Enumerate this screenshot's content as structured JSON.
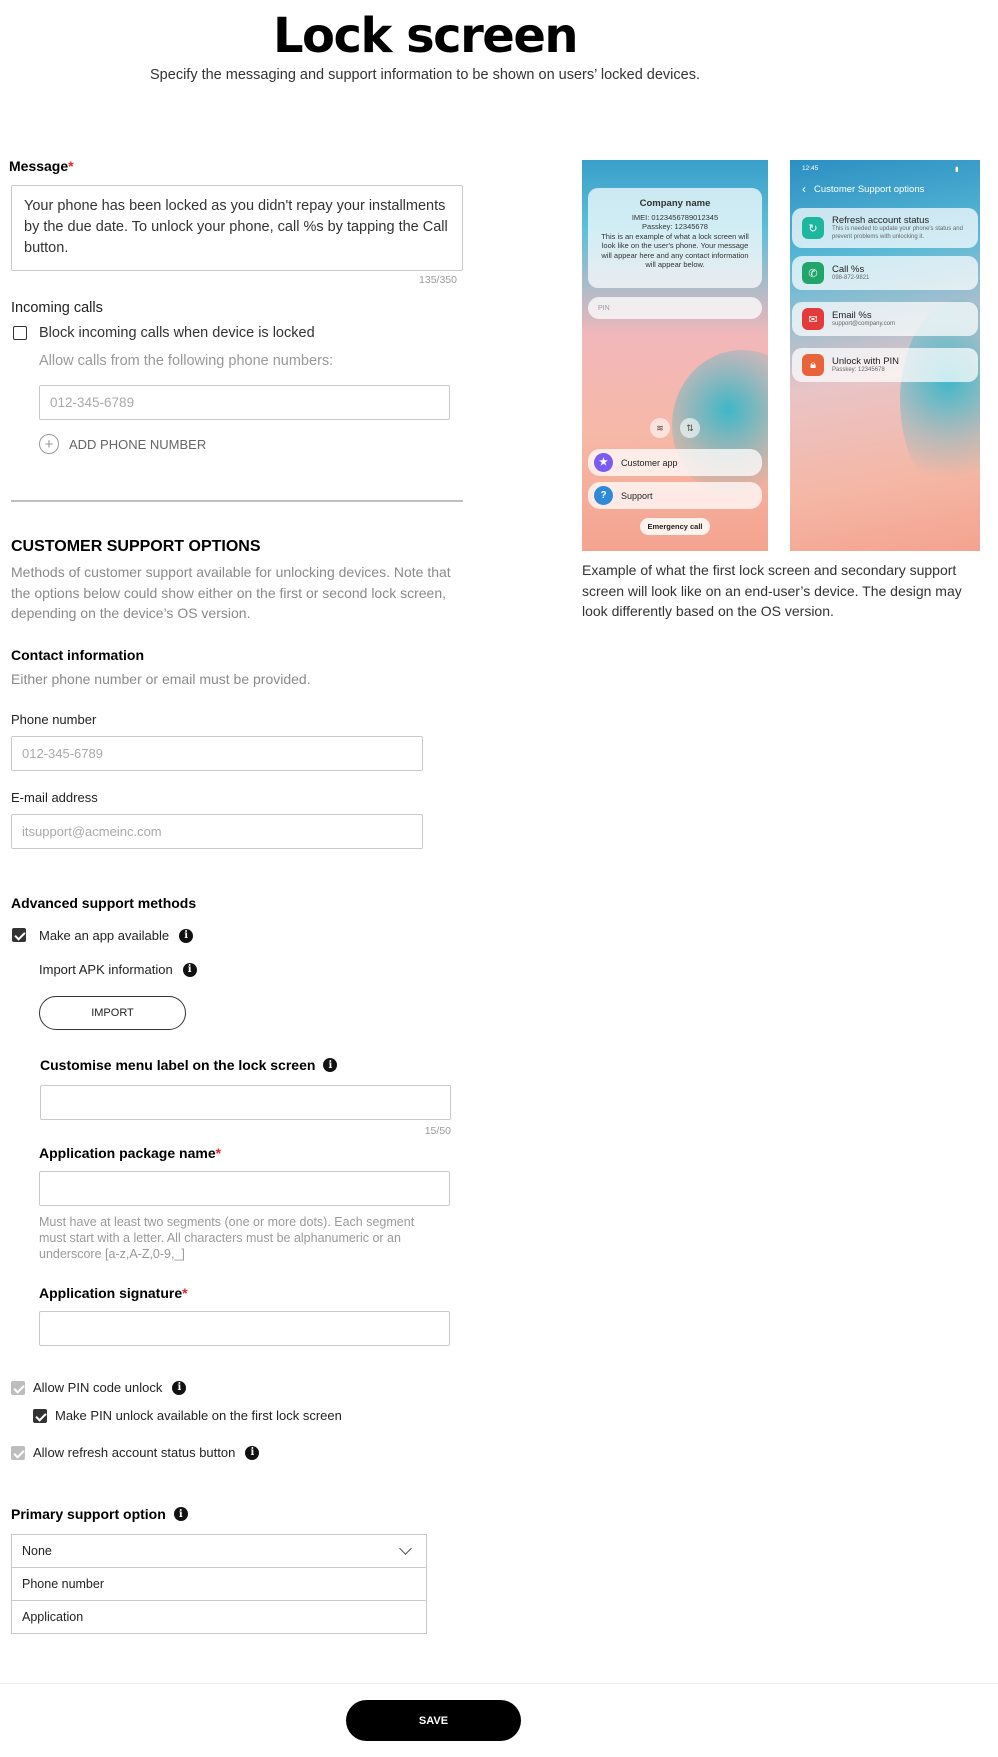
{
  "page": {
    "title": "Lock screen",
    "subtitle": "Specify the messaging and support information to be shown on users’ locked devices."
  },
  "message": {
    "label": "Message",
    "required_mark": "*",
    "value": "Your phone has been locked as you didn't repay your installments by the due date. To unlock your phone, call %s by tapping the Call button.",
    "counter": "135/350"
  },
  "incoming_calls": {
    "heading": "Incoming calls",
    "block_label": "Block incoming calls when device is locked",
    "block_checked": false,
    "allow_label": "Allow calls from the following phone numbers:",
    "phone_placeholder": "012-345-6789",
    "add_label": "ADD PHONE NUMBER"
  },
  "customer_support": {
    "heading": "CUSTOMER SUPPORT OPTIONS",
    "description": "Methods of customer support available for unlocking devices. Note that the options below could show either on the first or second lock screen, depending on the device’s OS version."
  },
  "contact": {
    "heading": "Contact information",
    "note": "Either phone number or email must be provided.",
    "phone_label": "Phone number",
    "phone_placeholder": "012-345-6789",
    "email_label": "E-mail address",
    "email_placeholder": "itsupport@acmeinc.com"
  },
  "advanced": {
    "heading": "Advanced support methods",
    "make_app_label": "Make an app available",
    "make_app_checked": true,
    "import_apk_label": "Import APK information",
    "import_button": "IMPORT",
    "menu_label_heading": "Customise menu label on the lock screen",
    "menu_label_counter": "15/50",
    "package_label": "Application package name",
    "package_help": "Must have at least two segments (one or more dots). Each segment must start with a letter. All characters must be alphanumeric or an underscore [a-z,A-Z,0-9,_]",
    "signature_label": "Application signature",
    "required_mark": "*"
  },
  "pin": {
    "allow_pin_label": "Allow PIN code unlock",
    "first_screen_label": "Make PIN unlock available on the first lock screen",
    "refresh_label": "Allow refresh account status button"
  },
  "primary_support": {
    "label": "Primary support option",
    "selected": "None",
    "options": [
      "Phone number",
      "Application"
    ]
  },
  "preview": {
    "screen1": {
      "company_name": "Company name",
      "imei": "IMEI: 0123456789012345",
      "passkey": "Passkey: 12345678",
      "example_text": "This is an example of what a lock screen will look like on the user's phone. Your message will appear here and any contact information will appear below.",
      "pin_placeholder": "PIN",
      "customer_app": "Customer app",
      "support": "Support",
      "emergency": "Emergency call"
    },
    "screen2": {
      "time": "12:45",
      "header": "Customer Support options",
      "options": [
        {
          "title": "Refresh account status",
          "sub": "This is needed to update your phone's status and prevent problems with unlocking it.",
          "color": "#1fb6a0",
          "icon": "refresh-icon"
        },
        {
          "title": "Call %s",
          "sub": "098-872-9821",
          "color": "#21a56b",
          "icon": "phone-icon"
        },
        {
          "title": "Email %s",
          "sub": "support@company.com",
          "color": "#e33b3b",
          "icon": "mail-icon"
        },
        {
          "title": "Unlock with PIN",
          "sub": "Passkey: 12345678",
          "color": "#e8623a",
          "icon": "lock-icon"
        }
      ]
    },
    "caption": "Example of what the first lock screen and secondary support screen will look like on an end-user’s device. The design may look differently based on the OS version."
  },
  "actions": {
    "save": "SAVE"
  },
  "colors": {
    "required": "#e0262b",
    "primary_button": "#000000",
    "customer_app_icon": "#7b5cf0",
    "support_icon": "#2e8ad8"
  }
}
